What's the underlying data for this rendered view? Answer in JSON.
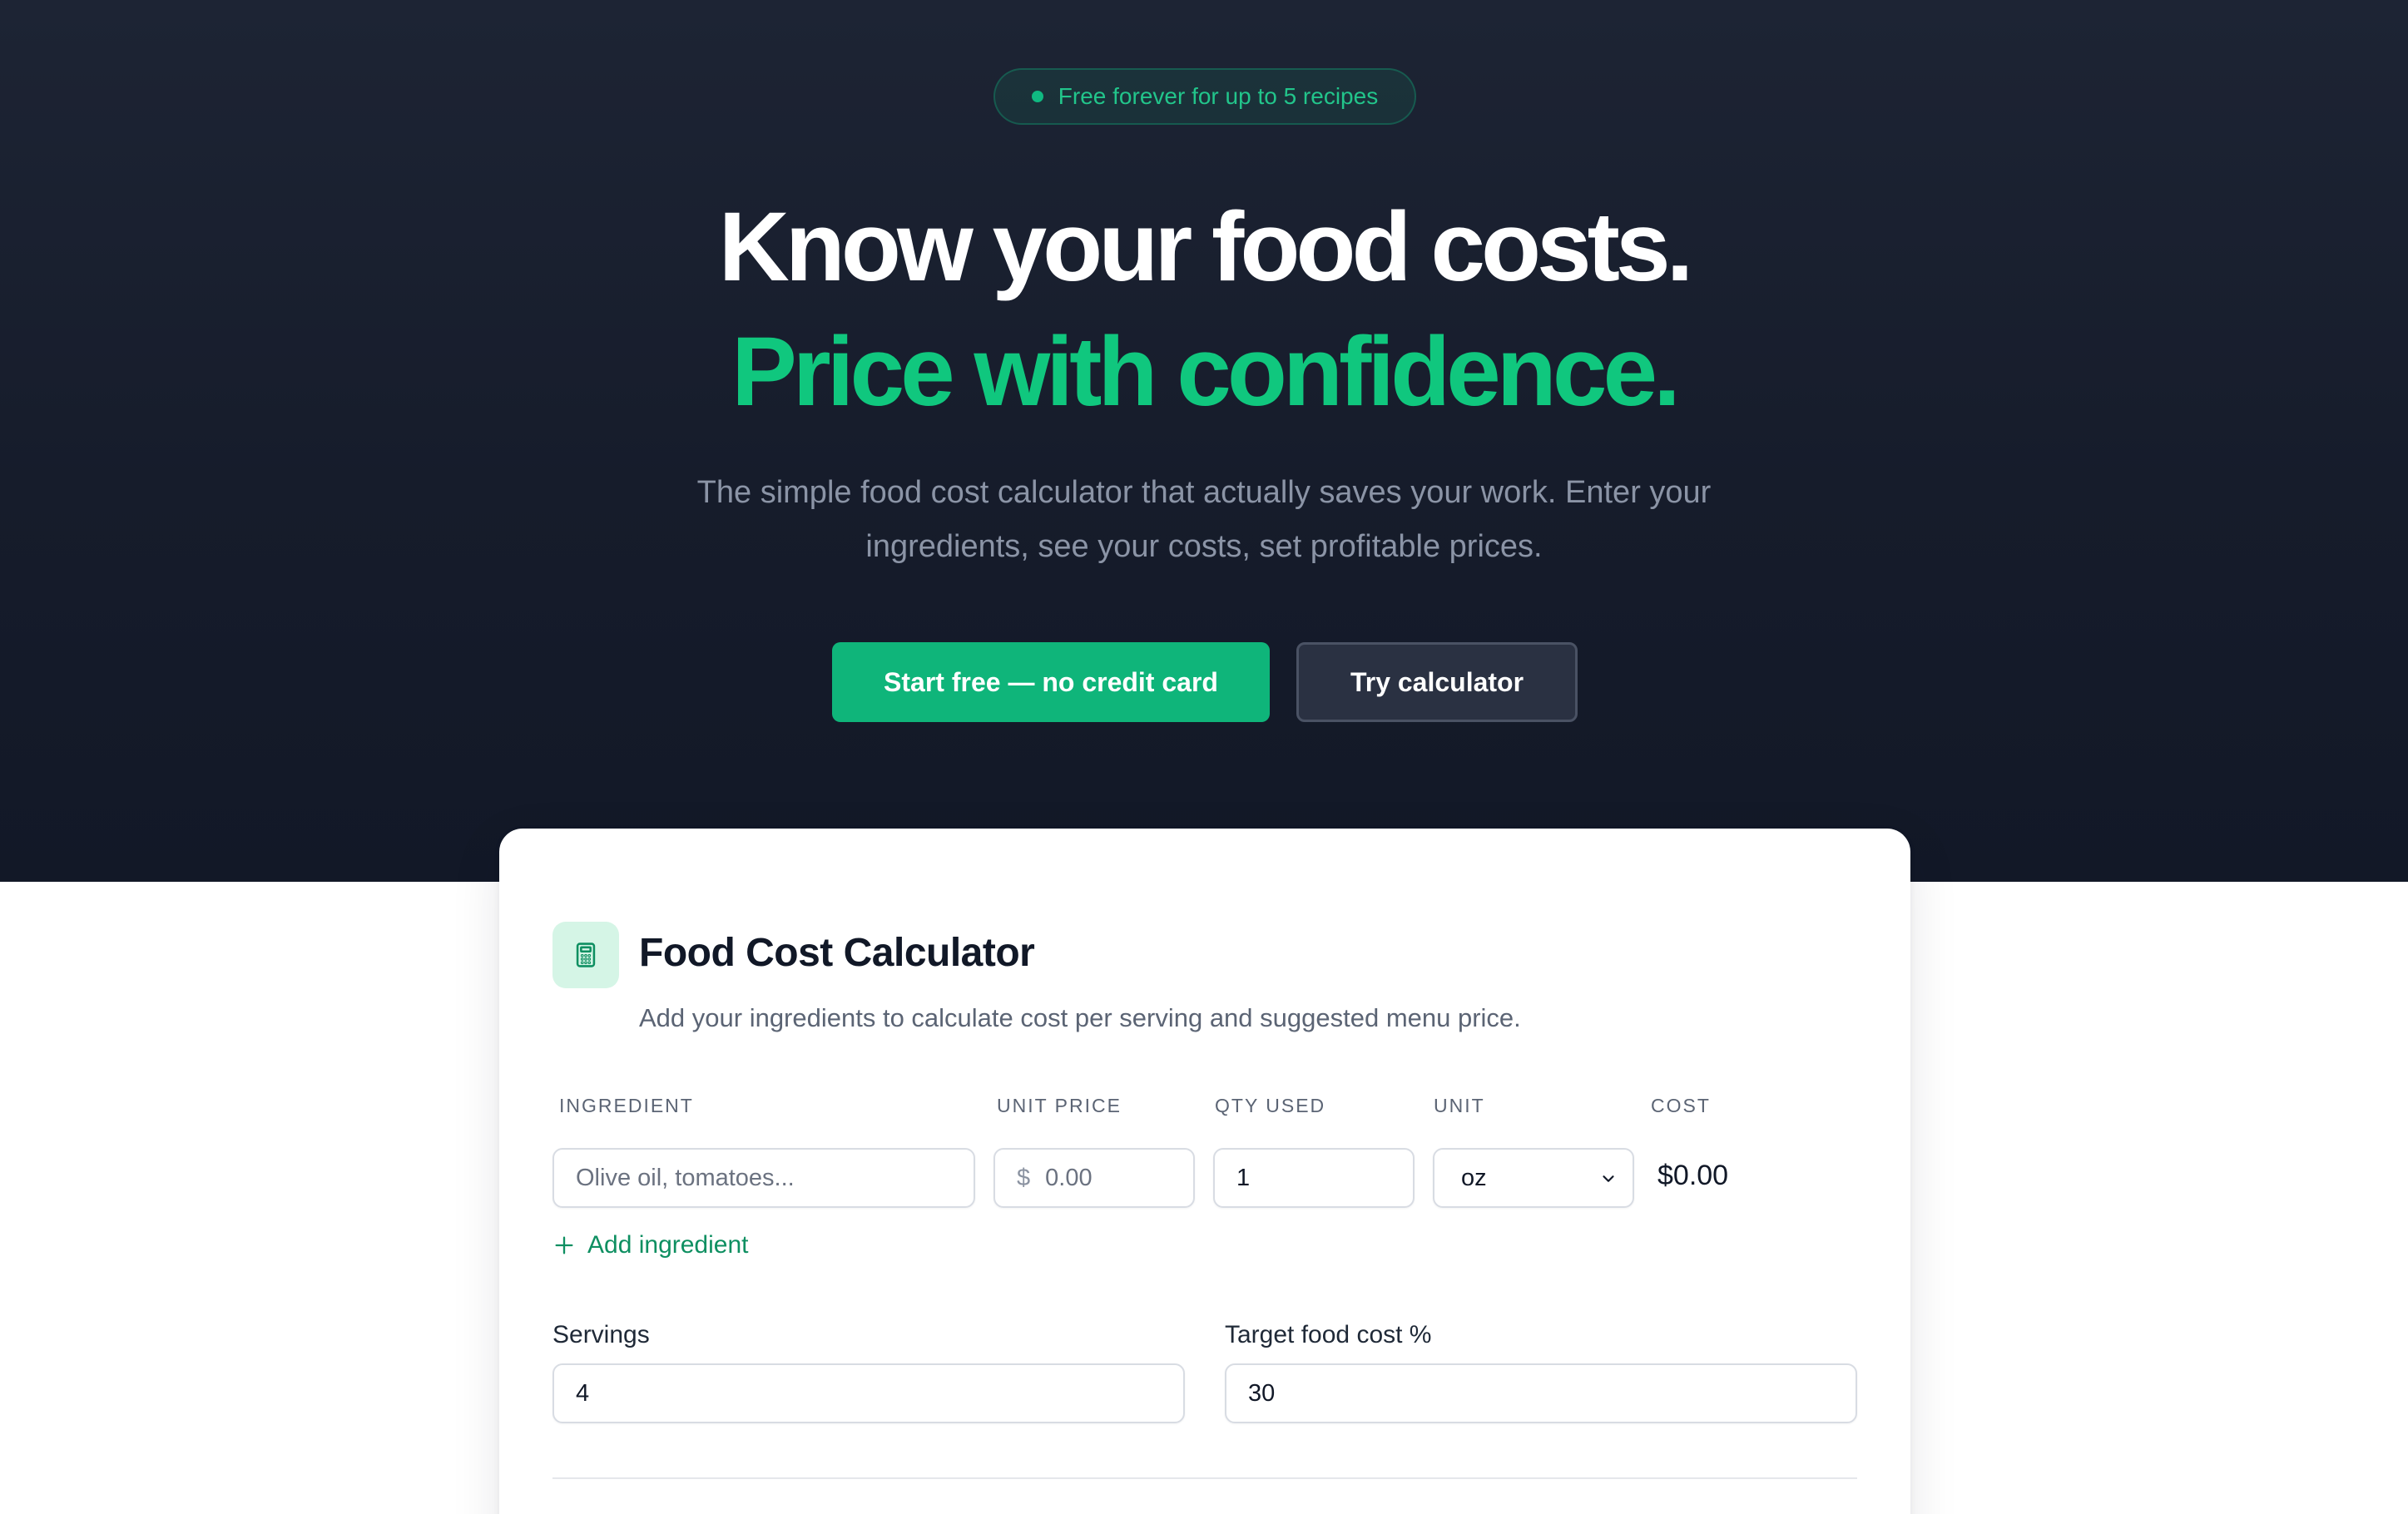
{
  "hero": {
    "badge": "Free forever for up to 5 recipes",
    "title_line1": "Know your food costs.",
    "title_line2": "Price with confidence.",
    "subtitle": "The simple food cost calculator that actually saves your work. Enter your ingredients, see your costs, set profitable prices.",
    "primary_cta": "Start free — no credit card",
    "secondary_cta": "Try calculator"
  },
  "calculator": {
    "icon": "calculator-icon",
    "title": "Food Cost Calculator",
    "description": "Add your ingredients to calculate cost per serving and suggested menu price.",
    "columns": {
      "ingredient": "INGREDIENT",
      "unit_price": "UNIT PRICE",
      "qty_used": "QTY USED",
      "unit": "UNIT",
      "cost": "COST"
    },
    "row": {
      "ingredient_placeholder": "Olive oil, tomatoes...",
      "price_prefix": "$",
      "price_placeholder": "0.00",
      "qty": "1",
      "unit": "oz",
      "cost": "$0.00"
    },
    "add_ingredient": "Add ingredient",
    "servings_label": "Servings",
    "servings_value": "4",
    "target_label": "Target food cost %",
    "target_value": "30"
  },
  "colors": {
    "accent": "#10b981",
    "hero_bg": "#1a2030"
  }
}
